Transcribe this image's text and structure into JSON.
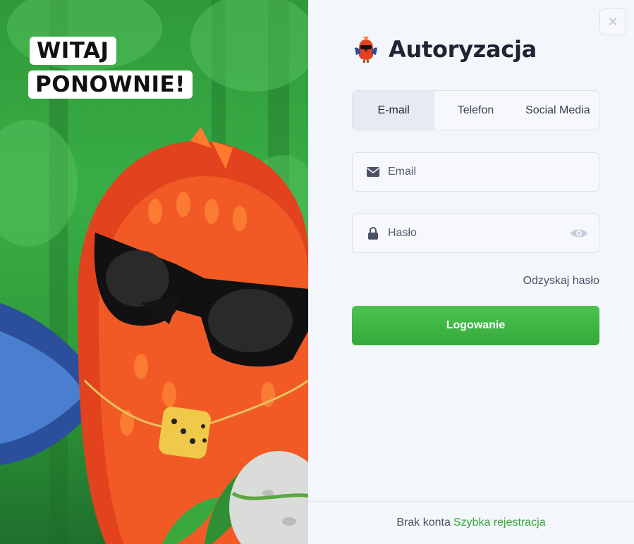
{
  "hero": {
    "welcome_line1": "WITAJ",
    "welcome_line2": "PONOWNIE!"
  },
  "auth": {
    "title": "Autoryzacja",
    "close_icon": "close-icon",
    "tabs": [
      {
        "label": "E-mail",
        "active": true
      },
      {
        "label": "Telefon",
        "active": false
      },
      {
        "label": "Social Media",
        "active": false
      }
    ],
    "email_field": {
      "placeholder": "Email",
      "value": "",
      "icon": "envelope-icon"
    },
    "password_field": {
      "placeholder": "Hasło",
      "value": "",
      "icon": "lock-icon",
      "toggle_icon": "eye-icon"
    },
    "recover_label": "Odzyskaj hasło",
    "login_label": "Logowanie",
    "footer": {
      "text": "Brak konta",
      "link": "Szybka rejestracja"
    }
  },
  "colors": {
    "accent_green": "#3cb441",
    "link_green": "#36a53c",
    "panel_bg": "#f3f6fb",
    "title_text": "#1f2434"
  }
}
